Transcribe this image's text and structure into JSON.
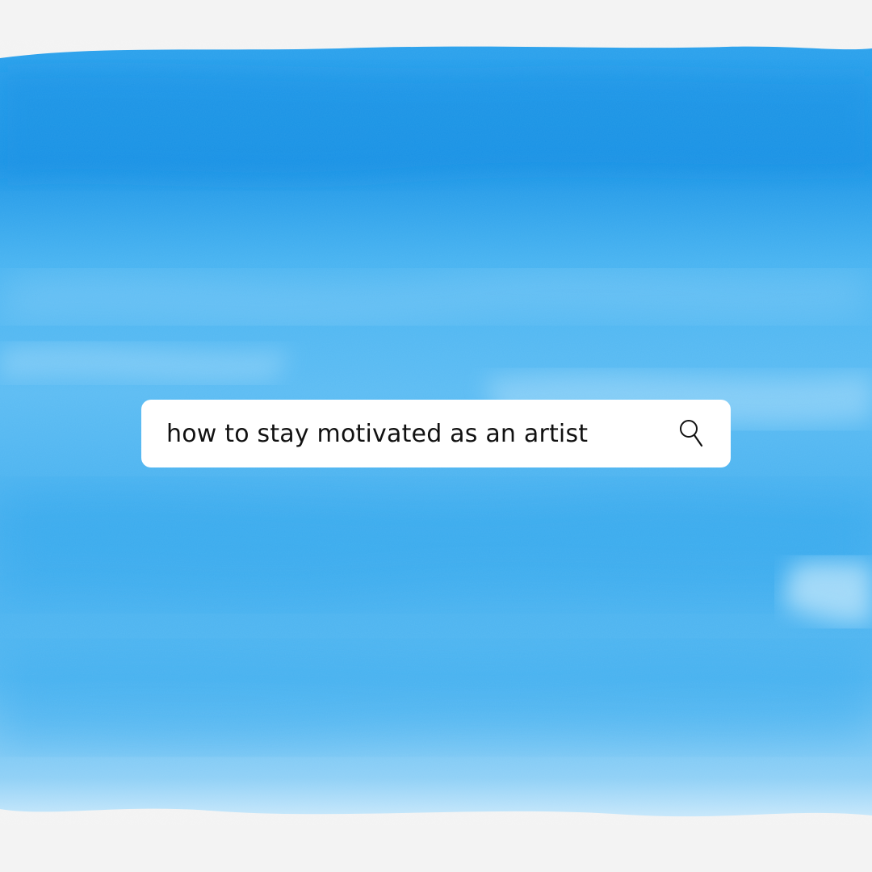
{
  "search": {
    "query": "how to stay motivated as an artist",
    "icon": "search-icon"
  },
  "colors": {
    "page_background": "#f3f3f3",
    "paint_dark": "#1a98e8",
    "paint_mid": "#3db0f0",
    "paint_light": "#7fcaf6",
    "search_bar_background": "#ffffff",
    "text": "#111111"
  }
}
